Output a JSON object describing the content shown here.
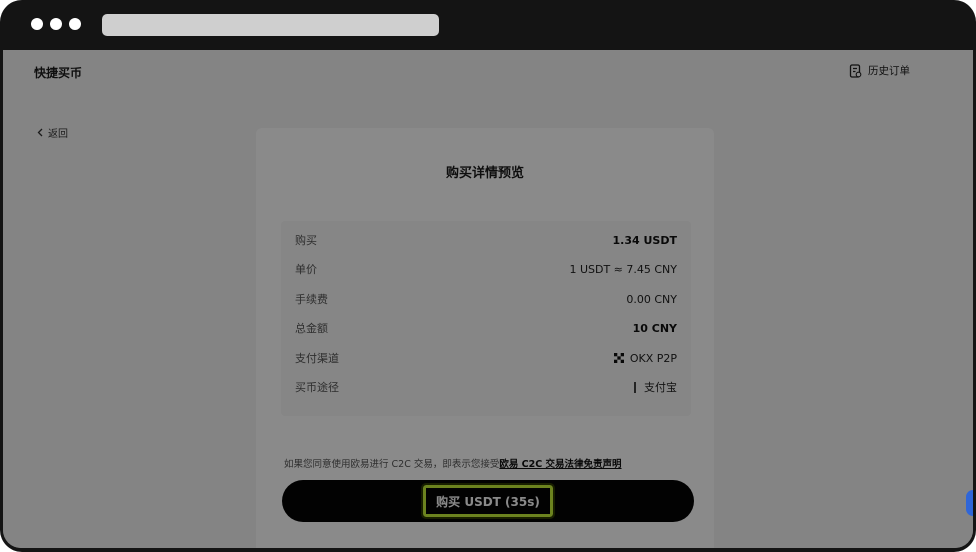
{
  "header": {
    "title": "快捷买币",
    "history_label": "历史订单",
    "history_icon": "receipt-icon"
  },
  "nav": {
    "back_label": "返回",
    "back_icon": "chevron-left-icon"
  },
  "card": {
    "title": "购买详情预览",
    "rows": [
      {
        "label": "购买",
        "value": "1.34 USDT",
        "bold": true
      },
      {
        "label": "单价",
        "value": "1 USDT ≈ 7.45 CNY",
        "bold": false
      },
      {
        "label": "手续费",
        "value": "0.00 CNY",
        "bold": false
      },
      {
        "label": "总金额",
        "value": "10 CNY",
        "bold": true
      },
      {
        "label": "支付渠道",
        "value": "OKX P2P",
        "bold": false,
        "icon": "okx-logo-icon"
      },
      {
        "label": "买币途径",
        "value": "支付宝",
        "bold": false,
        "icon": "bar-icon"
      }
    ],
    "disclaimer_text": "如果您同意使用欧易进行 C2C 交易，即表示您接受",
    "disclaimer_link": "欧易 C2C 交易法律免责声明",
    "buy_button_label": "购买 USDT (35s)"
  },
  "colors": {
    "button_bg": "#050505",
    "highlight": "#c7f23a",
    "background": "#f4f4f4",
    "card": "#ffffff"
  }
}
